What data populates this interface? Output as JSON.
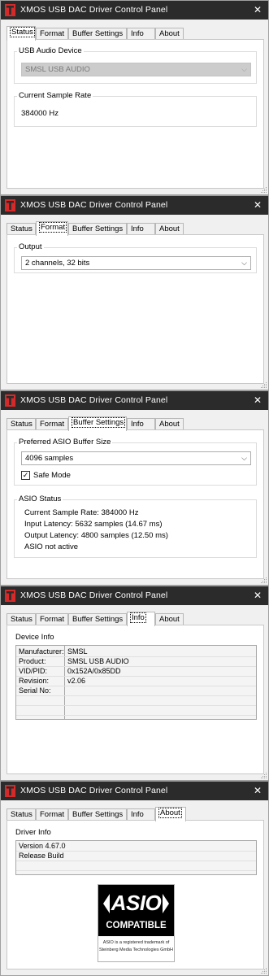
{
  "windows": [
    {
      "title": "XMOS USB DAC Driver Control Panel",
      "tabs": [
        "Status",
        "Format",
        "Buffer Settings",
        "Info",
        "About"
      ],
      "active_tab": "Status",
      "status": {
        "usb_device_group": "USB Audio Device",
        "device_combo": "SMSL USB AUDIO",
        "sample_rate_group": "Current Sample Rate",
        "sample_rate_value": "384000 Hz"
      }
    },
    {
      "title": "XMOS USB DAC Driver Control Panel",
      "tabs": [
        "Status",
        "Format",
        "Buffer Settings",
        "Info",
        "About"
      ],
      "active_tab": "Format",
      "format": {
        "output_group": "Output",
        "output_combo": "2 channels, 32 bits"
      }
    },
    {
      "title": "XMOS USB DAC Driver Control Panel",
      "tabs": [
        "Status",
        "Format",
        "Buffer Settings",
        "Info",
        "About"
      ],
      "active_tab": "Buffer Settings",
      "buffer": {
        "asio_buffer_group": "Preferred ASIO Buffer Size",
        "buffer_combo": "4096 samples",
        "safe_mode_label": "Safe Mode",
        "safe_mode_checked": true,
        "asio_status_group": "ASIO Status",
        "status_lines": [
          "Current Sample Rate: 384000 Hz",
          "Input Latency: 5632 samples (14.67 ms)",
          "Output Latency: 4800 samples (12.50 ms)",
          "ASIO not active"
        ]
      }
    },
    {
      "title": "XMOS USB DAC Driver Control Panel",
      "tabs": [
        "Status",
        "Format",
        "Buffer Settings",
        "Info",
        "About"
      ],
      "active_tab": "Info",
      "info": {
        "device_info_label": "Device Info",
        "rows": [
          {
            "key": "Manufacturer:",
            "value": "SMSL"
          },
          {
            "key": "Product:",
            "value": "SMSL USB AUDIO"
          },
          {
            "key": "VID/PID:",
            "value": "0x152A/0x85DD"
          },
          {
            "key": "Revision:",
            "value": "v2.06"
          },
          {
            "key": "Serial No:",
            "value": ""
          }
        ]
      }
    },
    {
      "title": "XMOS USB DAC Driver Control Panel",
      "tabs": [
        "Status",
        "Format",
        "Buffer Settings",
        "Info",
        "About"
      ],
      "active_tab": "About",
      "about": {
        "driver_info_label": "Driver Info",
        "lines": [
          "Version 4.67.0",
          "Release Build"
        ],
        "logo": {
          "asio_text": "ASIO",
          "compatible_text": "COMPATIBLE",
          "trademark_line1": "ASIO is a registered trademark of",
          "trademark_line2": "Steinberg Media Technologies GmbH"
        }
      }
    }
  ],
  "colors": {
    "titlebar": "#2b2b2b",
    "title_text": "#ffffff",
    "window_bg": "#f0f0f0",
    "panel_bg": "#ffffff",
    "app_icon_red": "#d42a2a"
  },
  "icons": {
    "app": "xmos-t-icon",
    "close": "close-icon",
    "dropdown": "chevron-down-icon",
    "checkmark": "checkmark-icon",
    "grip": "resize-grip-icon"
  }
}
